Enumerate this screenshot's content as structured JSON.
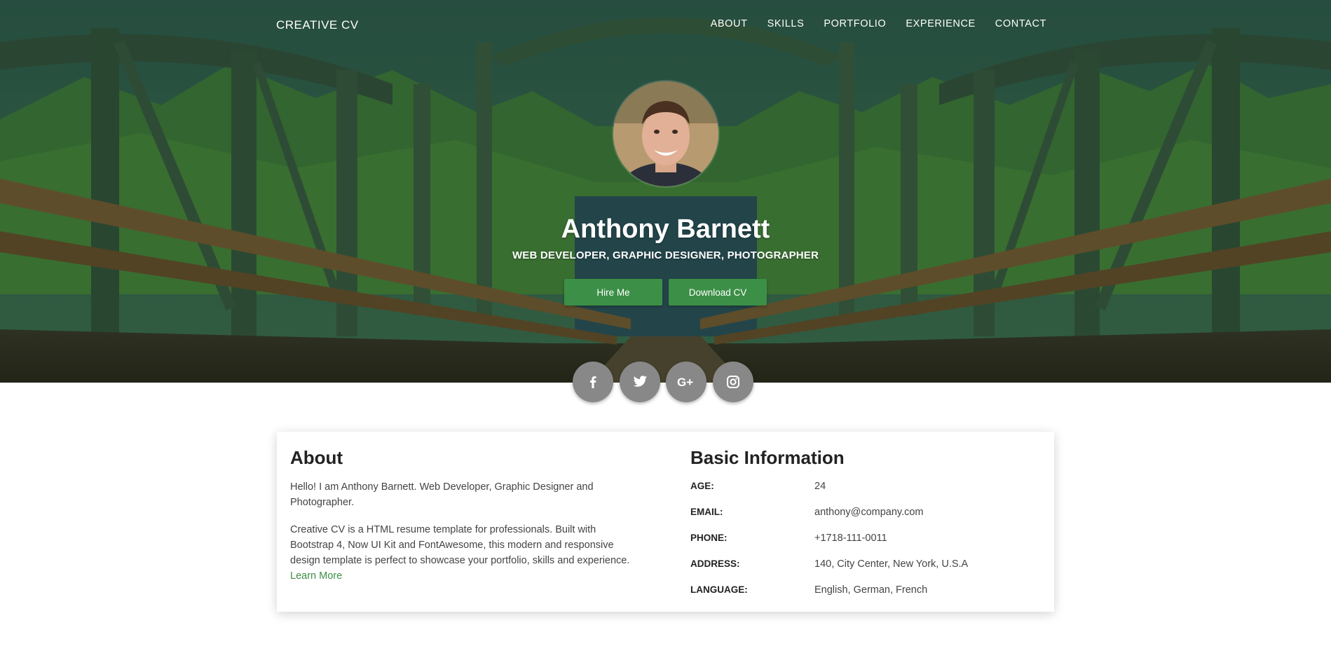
{
  "nav": {
    "brand": "CREATIVE CV",
    "items": [
      {
        "label": "ABOUT"
      },
      {
        "label": "SKILLS"
      },
      {
        "label": "PORTFOLIO"
      },
      {
        "label": "EXPERIENCE"
      },
      {
        "label": "CONTACT"
      }
    ]
  },
  "hero": {
    "name": "Anthony Barnett",
    "subtitle": "WEB DEVELOPER, GRAPHIC DESIGNER, PHOTOGRAPHER",
    "hire_label": "Hire Me",
    "download_label": "Download CV"
  },
  "social": [
    {
      "icon": "facebook-icon",
      "glyph": "f"
    },
    {
      "icon": "twitter-icon",
      "glyph": "t"
    },
    {
      "icon": "google-plus-icon",
      "glyph": "G+"
    },
    {
      "icon": "instagram-icon",
      "glyph": "ig"
    }
  ],
  "about": {
    "title": "About",
    "p1": "Hello! I am Anthony Barnett. Web Developer, Graphic Designer and Photographer.",
    "p2": "Creative CV is a HTML resume template for professionals. Built with Bootstrap 4, Now UI Kit and FontAwesome, this modern and responsive design template is perfect to showcase your portfolio, skills and experience.",
    "learn_more": "Learn More"
  },
  "basic_info": {
    "title": "Basic Information",
    "rows": [
      {
        "label": "AGE:",
        "value": "24"
      },
      {
        "label": "EMAIL:",
        "value": "anthony@company.com"
      },
      {
        "label": "PHONE:",
        "value": "+1718-111-0011"
      },
      {
        "label": "ADDRESS:",
        "value": "140, City Center, New York, U.S.A"
      },
      {
        "label": "LANGUAGE:",
        "value": "English, German, French"
      }
    ]
  },
  "colors": {
    "accent": "#3c8f46",
    "social_bg": "#888888"
  }
}
